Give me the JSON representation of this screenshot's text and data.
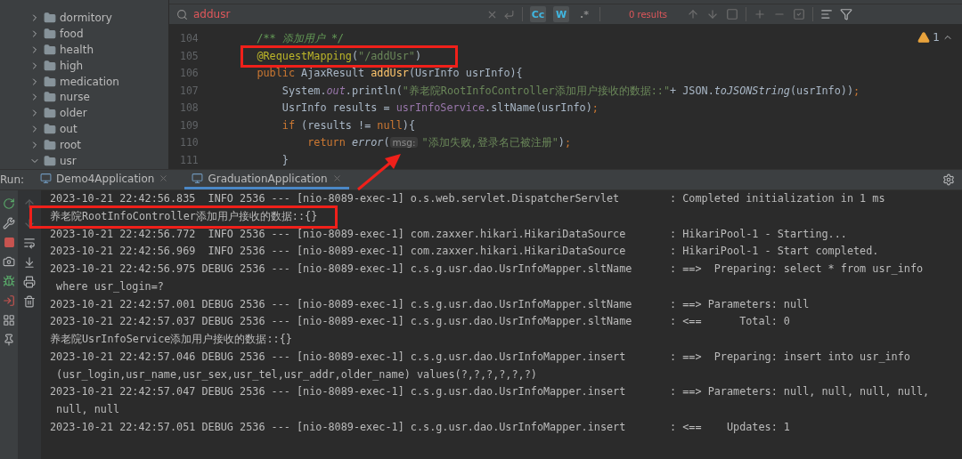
{
  "project_tree": {
    "items": [
      {
        "label": "dormitory",
        "expanded": false
      },
      {
        "label": "food",
        "expanded": false
      },
      {
        "label": "health",
        "expanded": false
      },
      {
        "label": "high",
        "expanded": false
      },
      {
        "label": "medication",
        "expanded": false
      },
      {
        "label": "nurse",
        "expanded": false
      },
      {
        "label": "older",
        "expanded": false
      },
      {
        "label": "out",
        "expanded": false
      },
      {
        "label": "root",
        "expanded": false
      },
      {
        "label": "usr",
        "expanded": true
      }
    ]
  },
  "search": {
    "value": "addusr",
    "options": [
      {
        "label": "Cc",
        "selected": true
      },
      {
        "label": "W",
        "selected": true
      },
      {
        "label": ".*",
        "selected": false
      }
    ],
    "result": "0 results"
  },
  "editor": {
    "warning_count": "1",
    "lines": [
      {
        "number": "104",
        "boxed": false,
        "tokens": [
          {
            "t": "    /** 添加用户 */",
            "kind": "comment"
          }
        ]
      },
      {
        "number": "105",
        "boxed": true,
        "tokens": [
          {
            "t": "    @RequestMapping",
            "kind": "annotation"
          },
          {
            "t": "("
          },
          {
            "t": "\"/addUsr\"",
            "kind": "string"
          },
          {
            "t": ")"
          }
        ]
      },
      {
        "number": "106",
        "boxed": false,
        "tokens": [
          {
            "t": "    public",
            "kind": "keyword"
          },
          {
            "t": " AjaxResult "
          },
          {
            "t": "addUsr",
            "kind": "decl"
          },
          {
            "t": "(UsrInfo usrInfo){"
          }
        ]
      },
      {
        "number": "107",
        "boxed": false,
        "tokens": [
          {
            "t": "        System."
          },
          {
            "t": "out",
            "kind": "static"
          },
          {
            "t": ".println("
          },
          {
            "t": "\"养老院RootInfoController添加用户接收的数据::\"",
            "kind": "string"
          },
          {
            "t": "+ JSON."
          },
          {
            "t": "toJSONString",
            "kind": "call"
          },
          {
            "t": "(usrInfo))"
          },
          {
            "t": ";",
            "kind": "keyword"
          }
        ]
      },
      {
        "number": "108",
        "boxed": false,
        "tokens": [
          {
            "t": "        UsrInfo results = "
          },
          {
            "t": "usrInfoService",
            "kind": "field"
          },
          {
            "t": ".sltName(usrInfo)"
          },
          {
            "t": ";",
            "kind": "keyword"
          }
        ]
      },
      {
        "number": "109",
        "boxed": false,
        "tokens": [
          {
            "t": "        if",
            "kind": "keyword"
          },
          {
            "t": " (results != "
          },
          {
            "t": "null",
            "kind": "keyword"
          },
          {
            "t": "){"
          }
        ]
      },
      {
        "number": "110",
        "boxed": false,
        "tokens": [
          {
            "t": "            return",
            "kind": "keyword"
          },
          {
            "t": " error",
            "kind": "call"
          },
          {
            "t": "("
          },
          {
            "t": "msg:",
            "kind": "hint"
          },
          {
            "t": "\"添加失败,登录名已被注册\"",
            "kind": "string"
          },
          {
            "t": ")"
          },
          {
            "t": ";",
            "kind": "keyword"
          }
        ]
      },
      {
        "number": "111",
        "boxed": false,
        "tokens": [
          {
            "t": "        }"
          }
        ]
      }
    ]
  },
  "run": {
    "label": "Run:",
    "tabs": [
      {
        "label": "Demo4Application",
        "selected": false
      },
      {
        "label": "GraduationApplication",
        "selected": true
      }
    ],
    "console": [
      {
        "text": "2023-10-21 22:42:56.835  INFO 2536 --- [nio-8089-exec-1] o.s.web.servlet.DispatcherServlet        : Completed initialization in 1 ms",
        "boxed": false
      },
      {
        "text": "养老院RootInfoController添加用户接收的数据::{}",
        "boxed": true
      },
      {
        "text": "2023-10-21 22:42:56.772  INFO 2536 --- [nio-8089-exec-1] com.zaxxer.hikari.HikariDataSource       : HikariPool-1 - Starting...",
        "boxed": false
      },
      {
        "text": "2023-10-21 22:42:56.969  INFO 2536 --- [nio-8089-exec-1] com.zaxxer.hikari.HikariDataSource       : HikariPool-1 - Start completed.",
        "boxed": false
      },
      {
        "text": "2023-10-21 22:42:56.975 DEBUG 2536 --- [nio-8089-exec-1] c.s.g.usr.dao.UsrInfoMapper.sltName      : ==>  Preparing: select * from usr_info",
        "boxed": false
      },
      {
        "text": " where usr_login=?",
        "boxed": false
      },
      {
        "text": "2023-10-21 22:42:57.001 DEBUG 2536 --- [nio-8089-exec-1] c.s.g.usr.dao.UsrInfoMapper.sltName      : ==> Parameters: null",
        "boxed": false
      },
      {
        "text": "2023-10-21 22:42:57.037 DEBUG 2536 --- [nio-8089-exec-1] c.s.g.usr.dao.UsrInfoMapper.sltName      : <==      Total: 0",
        "boxed": false
      },
      {
        "text": "养老院UsrInfoService添加用户接收的数据::{}",
        "boxed": false
      },
      {
        "text": "2023-10-21 22:42:57.046 DEBUG 2536 --- [nio-8089-exec-1] c.s.g.usr.dao.UsrInfoMapper.insert       : ==>  Preparing: insert into usr_info",
        "boxed": false
      },
      {
        "text": " (usr_login,usr_name,usr_sex,usr_tel,usr_addr,older_name) values(?,?,?,?,?,?)",
        "boxed": false
      },
      {
        "text": "2023-10-21 22:42:57.047 DEBUG 2536 --- [nio-8089-exec-1] c.s.g.usr.dao.UsrInfoMapper.insert       : ==> Parameters: null, null, null, null,",
        "boxed": false
      },
      {
        "text": " null, null",
        "boxed": false
      },
      {
        "text": "2023-10-21 22:42:57.051 DEBUG 2536 --- [nio-8089-exec-1] c.s.g.usr.dao.UsrInfoMapper.insert       : <==    Updates: 1",
        "boxed": false
      }
    ]
  }
}
